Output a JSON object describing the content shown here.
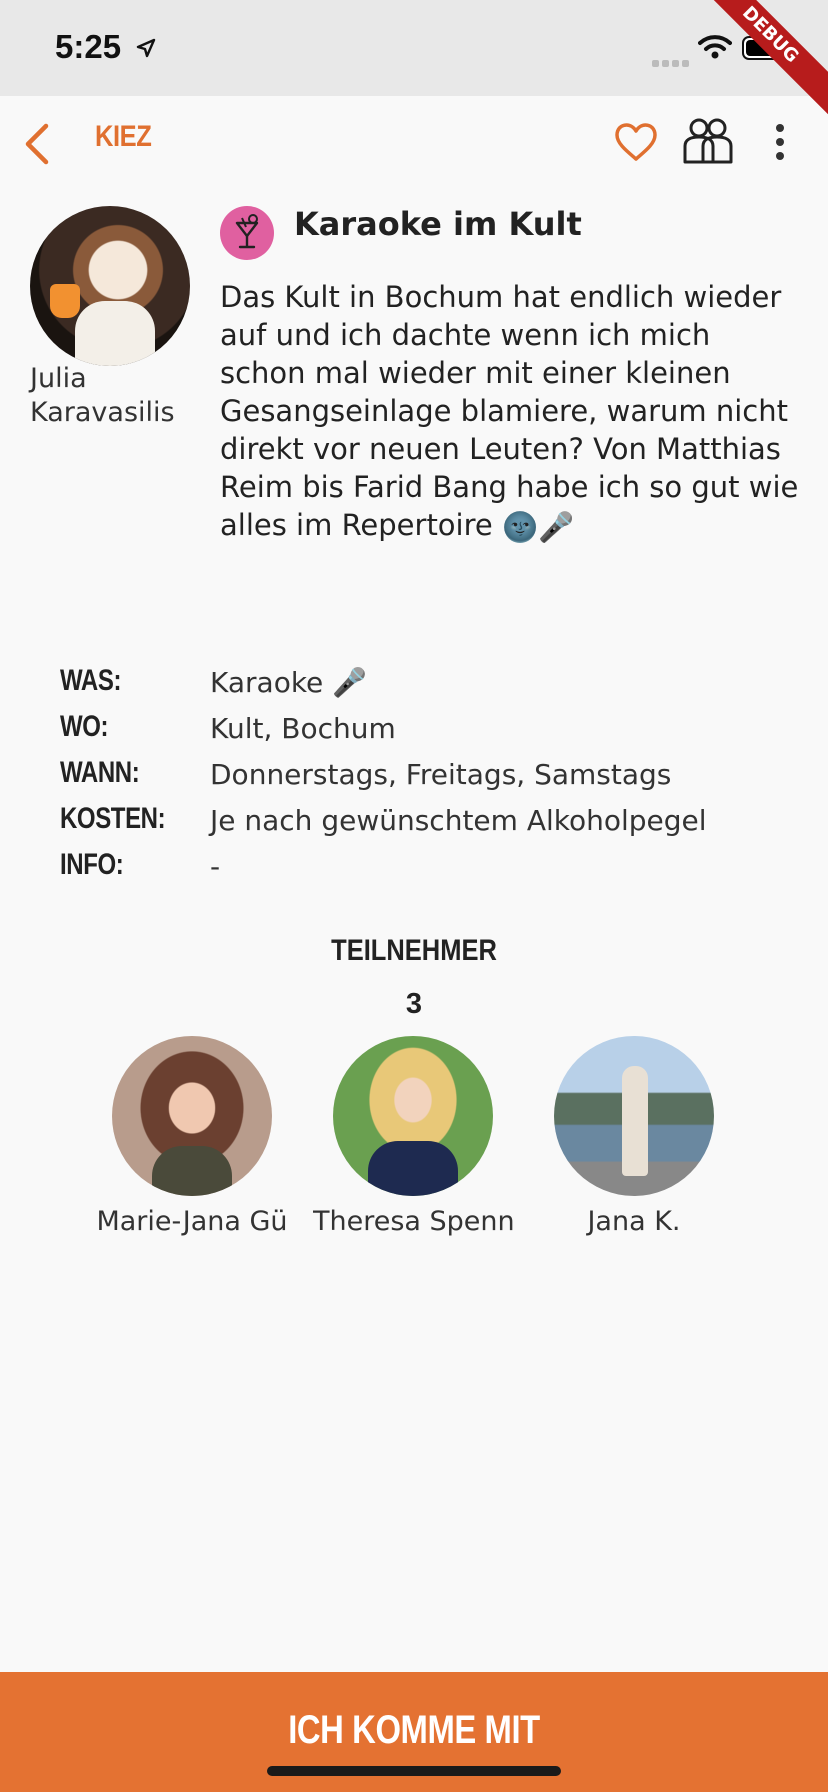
{
  "status_bar": {
    "time": "5:25",
    "debug_label": "DEBUG"
  },
  "nav": {
    "back_icon": "chevron-left-icon",
    "title": "KIEZ",
    "favorite_icon": "heart-outline-icon",
    "group_icon": "group-icon",
    "more_icon": "more-vertical-icon",
    "accent_color": "#e07030"
  },
  "host": {
    "name": "Julia Karavasilis"
  },
  "event": {
    "icon": "cocktail-icon",
    "icon_color": "#e060a0",
    "title": "Karaoke im Kult",
    "description": "Das Kult in Bochum hat endlich wieder auf und ich dachte wenn ich mich schon mal wieder mit einer kleinen Gesangseinlage blamiere, warum nicht direkt vor neuen Leuten? Von Matthias Reim bis Farid Bang habe ich so gut wie alles im Repertoire",
    "description_emoji": "🌚🎤"
  },
  "details": [
    {
      "label": "WAS:",
      "value": "Karaoke 🎤"
    },
    {
      "label": "WO:",
      "value": "Kult, Bochum"
    },
    {
      "label": "WANN:",
      "value": "Donnerstags, Freitags, Samstags"
    },
    {
      "label": "KOSTEN:",
      "value": "Je nach gewünschtem Alkoholpegel"
    },
    {
      "label": "INFO:",
      "value": "-"
    }
  ],
  "participants": {
    "title": "TEILNEHMER",
    "count": "3",
    "list": [
      {
        "name": "Marie-Jana Gü"
      },
      {
        "name": "Theresa Spenn"
      },
      {
        "name": "Jana K."
      }
    ]
  },
  "cta": {
    "label": "ICH KOMME MIT",
    "color": "#e47232"
  }
}
